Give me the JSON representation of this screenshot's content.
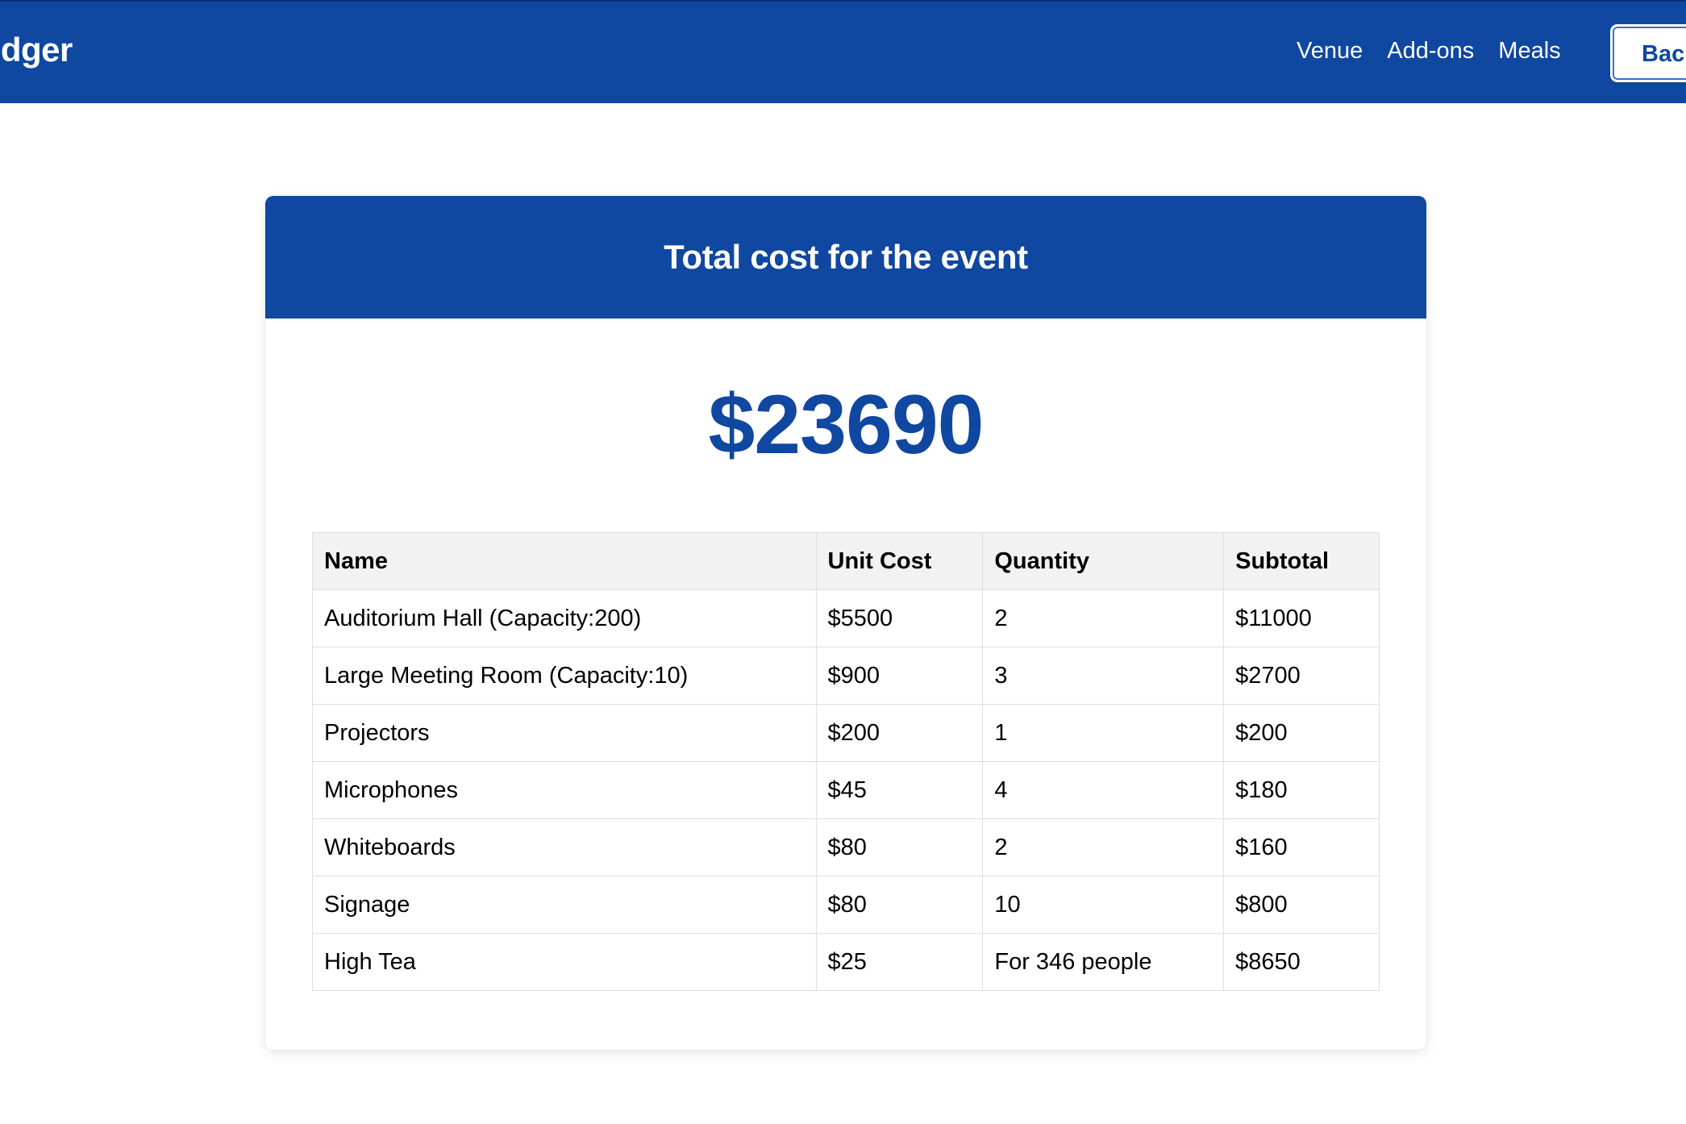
{
  "header": {
    "brand": "edger",
    "nav": [
      "Venue",
      "Add-ons",
      "Meals"
    ],
    "back_label": "Back"
  },
  "card": {
    "title": "Total cost for the event",
    "total": "$23690"
  },
  "table": {
    "columns": [
      "Name",
      "Unit Cost",
      "Quantity",
      "Subtotal"
    ],
    "rows": [
      [
        "Auditorium Hall (Capacity:200)",
        "$5500",
        "2",
        "$11000"
      ],
      [
        "Large Meeting Room (Capacity:10)",
        "$900",
        "3",
        "$2700"
      ],
      [
        "Projectors",
        "$200",
        "1",
        "$200"
      ],
      [
        "Microphones",
        "$45",
        "4",
        "$180"
      ],
      [
        "Whiteboards",
        "$80",
        "2",
        "$160"
      ],
      [
        "Signage",
        "$80",
        "10",
        "$800"
      ],
      [
        "High Tea",
        "$25",
        "For 346 people",
        "$8650"
      ]
    ]
  },
  "colors": {
    "primary": "#0f47a1",
    "header_row_bg": "#f2f2f2",
    "border": "#dedede"
  }
}
